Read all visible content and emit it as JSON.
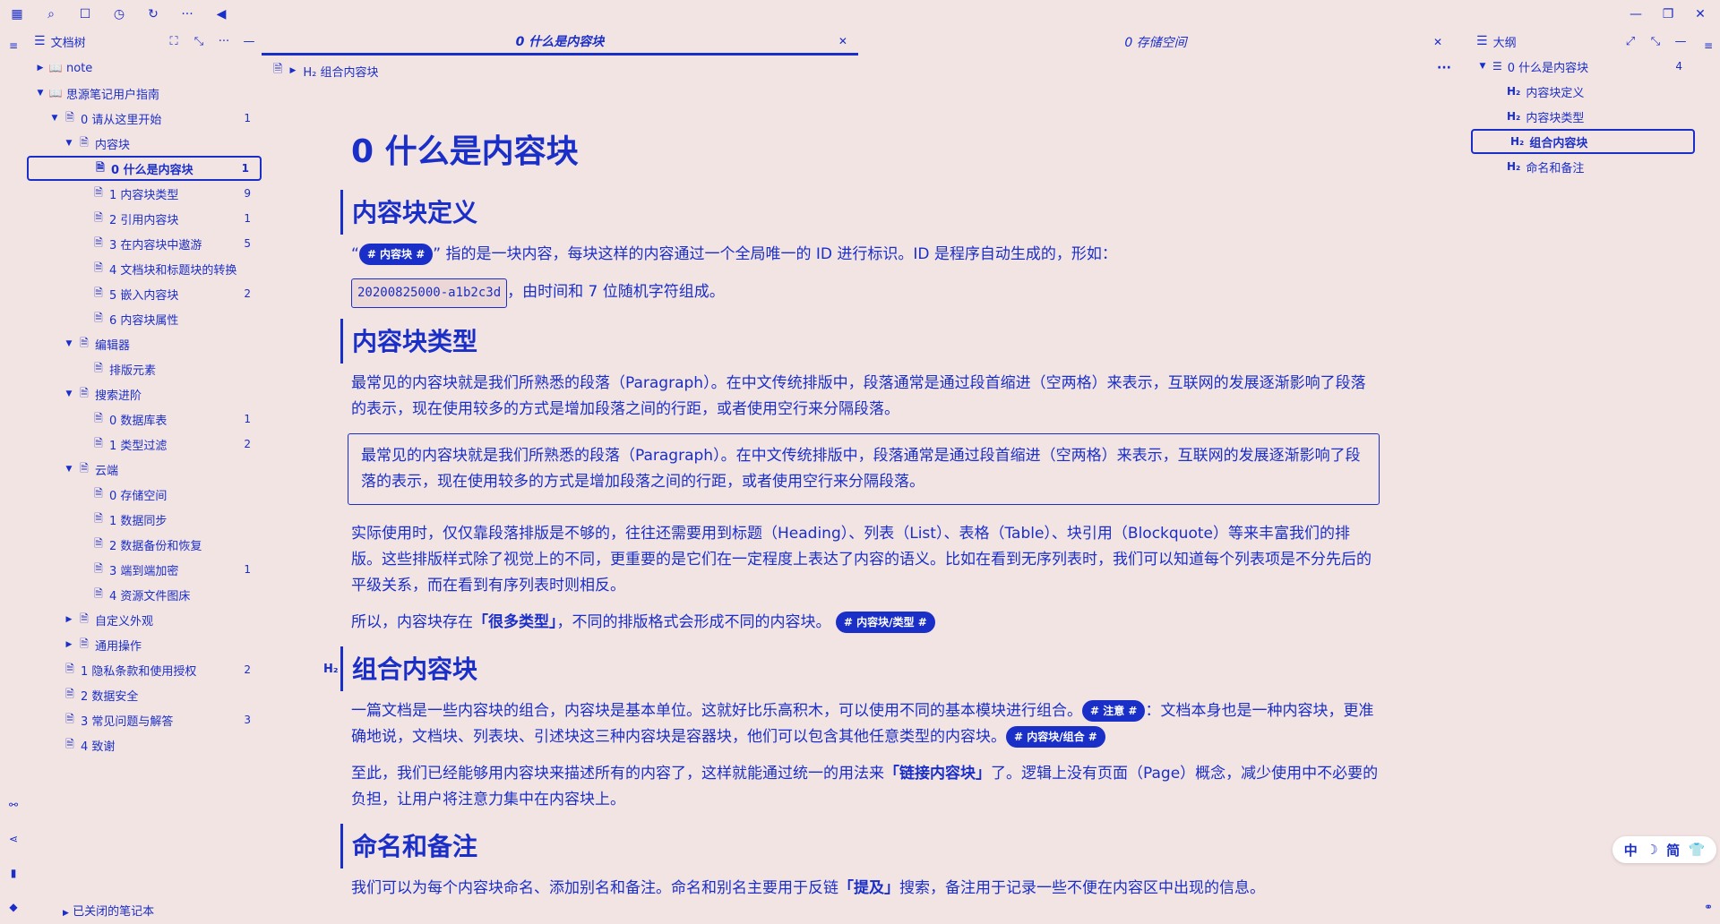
{
  "topbar": {
    "icons": [
      "calendar-icon",
      "search-icon",
      "square-icon",
      "history-icon",
      "refresh-icon",
      "more-icon",
      "collapse-left-icon"
    ],
    "glyphs": [
      "▦",
      "⌕",
      "☐",
      "◷",
      "↻",
      "···",
      "◀"
    ]
  },
  "window": {
    "minimize": "—",
    "restore": "❐",
    "close": "✕"
  },
  "tree_panel": {
    "title": "文档树",
    "items": [
      {
        "label": "note",
        "level": 0,
        "arrow": "▶",
        "icon": "📖",
        "count": ""
      },
      {
        "label": "思源笔记用户指南",
        "level": 0,
        "arrow": "▼",
        "icon": "📖",
        "count": ""
      },
      {
        "label": "0 请从这里开始",
        "level": 1,
        "arrow": "▼",
        "icon": "🗎",
        "count": "1"
      },
      {
        "label": "内容块",
        "level": 2,
        "arrow": "▼",
        "icon": "🗎",
        "count": ""
      },
      {
        "label": "0 什么是内容块",
        "level": 3,
        "arrow": "",
        "icon": "🗎",
        "count": "1",
        "active": true
      },
      {
        "label": "1 内容块类型",
        "level": 3,
        "arrow": "",
        "icon": "🗎",
        "count": "9"
      },
      {
        "label": "2 引用内容块",
        "level": 3,
        "arrow": "",
        "icon": "🗎",
        "count": "1"
      },
      {
        "label": "3 在内容块中遨游",
        "level": 3,
        "arrow": "",
        "icon": "🗎",
        "count": "5"
      },
      {
        "label": "4 文档块和标题块的转换",
        "level": 3,
        "arrow": "",
        "icon": "🗎",
        "count": ""
      },
      {
        "label": "5 嵌入内容块",
        "level": 3,
        "arrow": "",
        "icon": "🗎",
        "count": "2"
      },
      {
        "label": "6 内容块属性",
        "level": 3,
        "arrow": "",
        "icon": "🗎",
        "count": ""
      },
      {
        "label": "编辑器",
        "level": 2,
        "arrow": "▼",
        "icon": "🗎",
        "count": ""
      },
      {
        "label": "排版元素",
        "level": 3,
        "arrow": "",
        "icon": "🗎",
        "count": ""
      },
      {
        "label": "搜索进阶",
        "level": 2,
        "arrow": "▼",
        "icon": "🗎",
        "count": ""
      },
      {
        "label": "0 数据库表",
        "level": 3,
        "arrow": "",
        "icon": "🗎",
        "count": "1"
      },
      {
        "label": "1 类型过滤",
        "level": 3,
        "arrow": "",
        "icon": "🗎",
        "count": "2"
      },
      {
        "label": "云端",
        "level": 2,
        "arrow": "▼",
        "icon": "🗎",
        "count": ""
      },
      {
        "label": "0 存储空间",
        "level": 3,
        "arrow": "",
        "icon": "🗎",
        "count": ""
      },
      {
        "label": "1 数据同步",
        "level": 3,
        "arrow": "",
        "icon": "🗎",
        "count": ""
      },
      {
        "label": "2 数据备份和恢复",
        "level": 3,
        "arrow": "",
        "icon": "🗎",
        "count": ""
      },
      {
        "label": "3 端到端加密",
        "level": 3,
        "arrow": "",
        "icon": "🗎",
        "count": "1"
      },
      {
        "label": "4 资源文件图床",
        "level": 3,
        "arrow": "",
        "icon": "🗎",
        "count": ""
      },
      {
        "label": "自定义外观",
        "level": 2,
        "arrow": "▶",
        "icon": "🗎",
        "count": ""
      },
      {
        "label": "通用操作",
        "level": 2,
        "arrow": "▶",
        "icon": "🗎",
        "count": ""
      },
      {
        "label": "1 隐私条款和使用授权",
        "level": 1,
        "arrow": "",
        "icon": "🗎",
        "count": "2"
      },
      {
        "label": "2 数据安全",
        "level": 1,
        "arrow": "",
        "icon": "🗎",
        "count": ""
      },
      {
        "label": "3 常见问题与解答",
        "level": 1,
        "arrow": "",
        "icon": "🗎",
        "count": "3"
      },
      {
        "label": "4 致谢",
        "level": 1,
        "arrow": "",
        "icon": "🗎",
        "count": ""
      }
    ],
    "closed_notebooks": "已关闭的笔记本"
  },
  "tabs": [
    {
      "label": "0 什么是内容块",
      "active": true
    },
    {
      "label": "0 存储空间",
      "active": false
    }
  ],
  "breadcrumb": {
    "heading": "H₂ 组合内容块"
  },
  "doc": {
    "title": "0 什么是内容块",
    "h_def": "内容块定义",
    "def_q_open": "“",
    "def_tag": "# 内容块 #",
    "def_text": "” 指的是一块内容，每块这样的内容通过一个全局唯一的 ID 进行标识。ID 是程序自动生成的，形如：",
    "id_code": "20200825000-a1b2c3d",
    "id_text": "，由时间和 7 位随机字符组成。",
    "h_types": "内容块类型",
    "types_p1": "最常见的内容块就是我们所熟悉的段落（Paragraph）。在中文传统排版中，段落通常是通过段首缩进（空两格）来表示，互联网的发展逐渐影响了段落的表示，现在使用较多的方式是增加段落之间的行距，或者使用空行来分隔段落。",
    "types_box": "最常见的内容块就是我们所熟悉的段落（Paragraph）。在中文传统排版中，段落通常是通过段首缩进（空两格）来表示，互联网的发展逐渐影响了段落的表示，现在使用较多的方式是增加段落之间的行距，或者使用空行来分隔段落。",
    "types_p2": "实际使用时，仅仅靠段落排版是不够的，往往还需要用到标题（Heading）、列表（List）、表格（Table）、块引用（Blockquote）等来丰富我们的排版。这些排版样式除了视觉上的不同，更重要的是它们在一定程度上表达了内容的语义。比如在看到无序列表时，我们可以知道每个列表项是不分先后的平级关系，而在看到有序列表时则相反。",
    "types_p3a": "所以，内容块存在",
    "types_p3b": "「很多类型」",
    "types_p3c": "，不同的排版格式会形成不同的内容块。",
    "types_tag": "# 内容块/类型 #",
    "h_combine": "组合内容块",
    "h_combine_mark": "H₂",
    "comb_p1a": "一篇文档是一些内容块的组合，内容块是基本单位。这就好比乐高积木，可以使用不同的基本模块进行组合。",
    "comb_tag1": "# 注意 #",
    "comb_p1b": "：文档本身也是一种内容块，更准确地说，文档块、列表块、引述块这三种内容块是容器块，他们可以包含其他任意类型的内容块。",
    "comb_tag2": "# 内容块/组合 #",
    "comb_p2a": "至此，我们已经能够用内容块来描述所有的内容了，这样就能通过统一的用法来",
    "comb_p2b": "「链接内容块」",
    "comb_p2c": "了。逻辑上没有页面（Page）概念，减少使用中不必要的负担，让用户将注意力集中在内容块上。",
    "h_name": "命名和备注",
    "name_p1a": "我们可以为每个内容块命名、添加别名和备注。命名和别名主要用于反链",
    "name_p1b": "「提及」",
    "name_p1c": "搜索，备注用于记录一些不便在内容区中出现的信息。"
  },
  "outline_panel": {
    "title": "大纲",
    "items": [
      {
        "label": "0 什么是内容块",
        "level": 0,
        "arrow": "▼",
        "icon": "☰",
        "count": "4"
      },
      {
        "label": "内容块定义",
        "level": 1,
        "arrow": "",
        "icon": "H₂",
        "count": ""
      },
      {
        "label": "内容块类型",
        "level": 1,
        "arrow": "",
        "icon": "H₂",
        "count": ""
      },
      {
        "label": "组合内容块",
        "level": 1,
        "arrow": "",
        "icon": "H₂",
        "count": "",
        "active": true
      },
      {
        "label": "命名和备注",
        "level": 1,
        "arrow": "",
        "icon": "H₂",
        "count": ""
      }
    ]
  },
  "lang_pill": {
    "zh": "中",
    "moon": "☽",
    "simp": "简",
    "shirt": "👕"
  },
  "colors": {
    "accent": "#1a2ec8",
    "background": "#f3e4e4"
  }
}
